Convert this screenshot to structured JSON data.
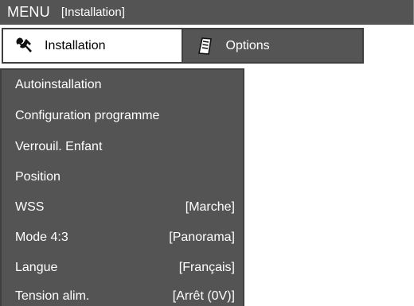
{
  "header": {
    "menu_label": "MENU",
    "section_label": "[Installation]"
  },
  "tabs": [
    {
      "label": "Installation",
      "icon": "wrench-icon",
      "active": true
    },
    {
      "label": "Options",
      "icon": "document-icon",
      "active": false
    }
  ],
  "menu_items": [
    {
      "label": "Autoinstallation",
      "value": ""
    },
    {
      "label": "Configuration programme",
      "value": ""
    },
    {
      "label": "Verrouil. Enfant",
      "value": ""
    },
    {
      "label": "Position",
      "value": ""
    },
    {
      "label": "WSS",
      "value": "[Marche]"
    },
    {
      "label": "Mode 4:3",
      "value": "[Panorama]"
    },
    {
      "label": "Langue",
      "value": "[Français]"
    },
    {
      "label": "Tension alim.",
      "value": "[Arrêt (0V)]"
    }
  ],
  "colors": {
    "panel_bg": "#545454",
    "border": "#3f3f3f",
    "text": "#ffffff"
  }
}
